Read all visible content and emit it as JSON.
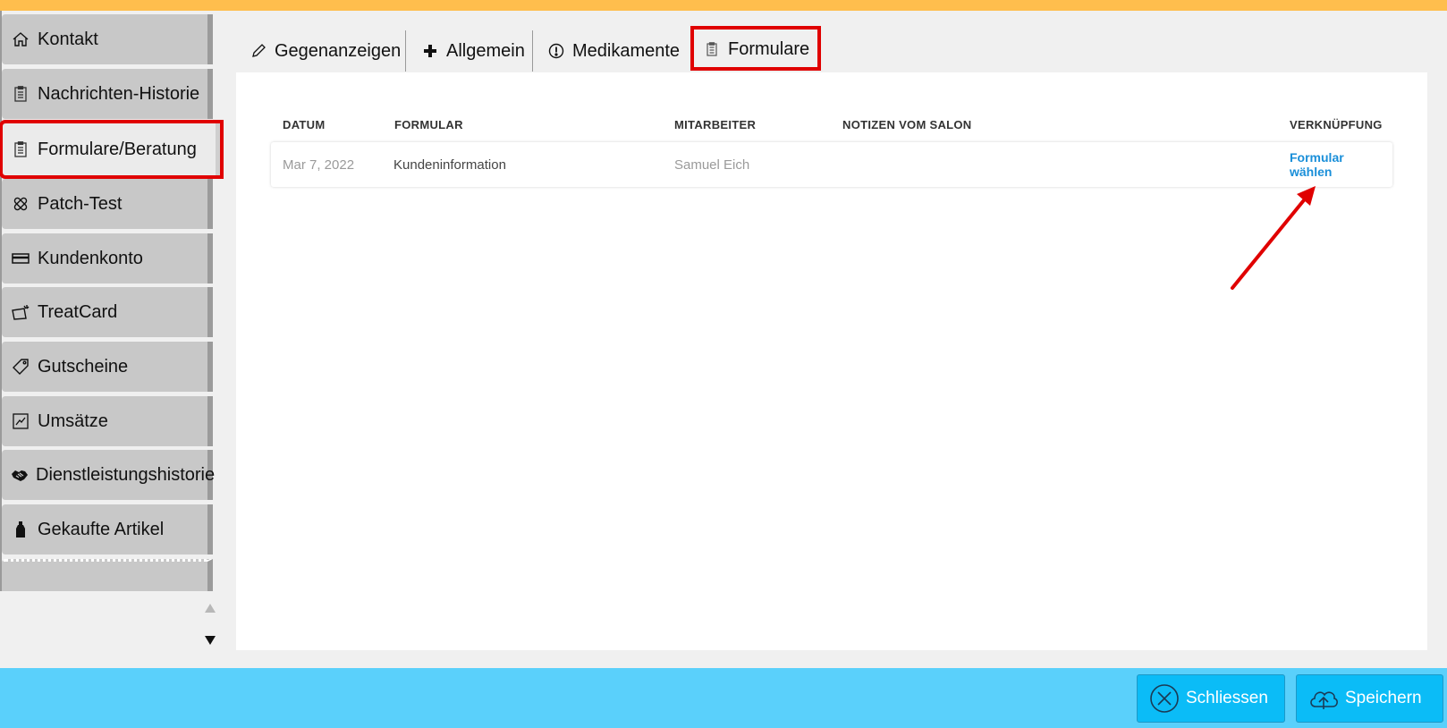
{
  "sidebar": {
    "items": [
      {
        "label": "Kontakt",
        "icon": "home-icon"
      },
      {
        "label": "Nachrichten-Historie",
        "icon": "clipboard-icon"
      },
      {
        "label": "Formulare/Beratung",
        "icon": "clipboard-icon",
        "active": true
      },
      {
        "label": "Patch-Test",
        "icon": "bandage-icon"
      },
      {
        "label": "Kundenkonto",
        "icon": "card-icon"
      },
      {
        "label": "TreatCard",
        "icon": "treatcard-icon"
      },
      {
        "label": "Gutscheine",
        "icon": "tag-icon"
      },
      {
        "label": "Umsätze",
        "icon": "chart-icon"
      },
      {
        "label": "Dienstleistungshistorie",
        "icon": "handshake-icon"
      },
      {
        "label": "Gekaufte Artikel",
        "icon": "bottle-icon"
      }
    ]
  },
  "tabs": [
    {
      "label": "Gegenanzeigen",
      "icon": "pencil-icon"
    },
    {
      "label": "Allgemein",
      "icon": "plus-icon"
    },
    {
      "label": "Medikamente",
      "icon": "alert-circle-icon"
    },
    {
      "label": "Formulare",
      "icon": "clipboard-icon",
      "active": true
    }
  ],
  "table": {
    "headers": {
      "date": "DATUM",
      "form": "FORMULAR",
      "staff": "MITARBEITER",
      "notes": "NOTIZEN VOM SALON",
      "link": "VERKNÜPFUNG"
    },
    "rows": [
      {
        "date": "Mar 7, 2022",
        "form": "Kundeninformation",
        "staff": "Samuel Eich",
        "notes": "",
        "link": "Formular wählen"
      }
    ]
  },
  "footer": {
    "close_label": "Schliessen",
    "save_label": "Speichern"
  },
  "colors": {
    "top_accent": "#ffbe4d",
    "footer": "#5ad0fb",
    "button": "#0bbcf7",
    "link": "#1a8fd9",
    "highlight": "#e00000"
  }
}
